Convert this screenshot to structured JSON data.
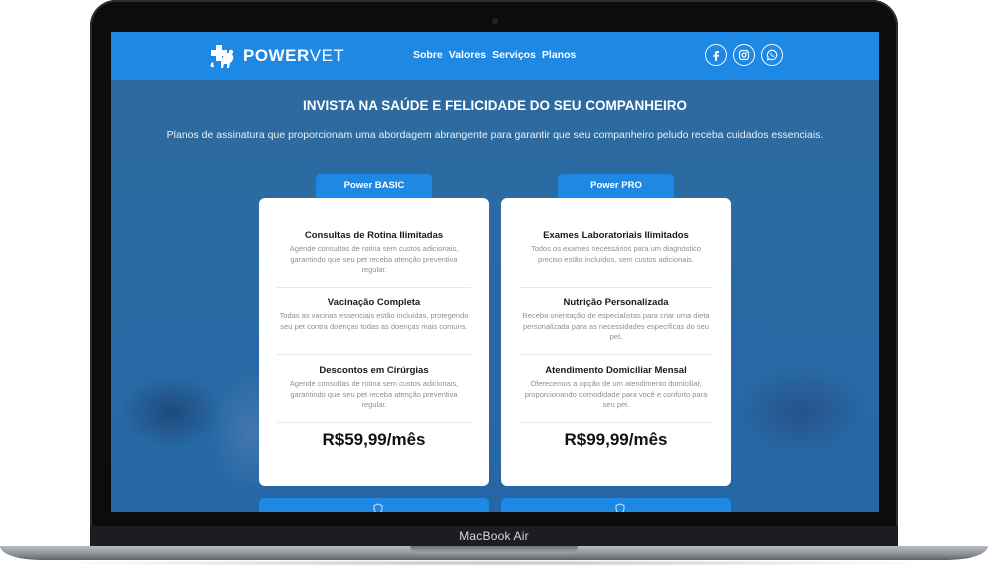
{
  "device": {
    "label": "MacBook Air"
  },
  "navbar": {
    "logo": {
      "brand_bold": "POWER",
      "brand_light": "VET",
      "icon": "pet-health-logo-icon"
    },
    "links": [
      {
        "label": "Sobre"
      },
      {
        "label": "Valores"
      },
      {
        "label": "Serviços"
      },
      {
        "label": "Planos"
      }
    ],
    "socials": [
      {
        "icon": "facebook-icon"
      },
      {
        "icon": "instagram-icon"
      },
      {
        "icon": "whatsapp-icon"
      }
    ]
  },
  "hero": {
    "title": "INVISTA NA SAÚDE E FELICIDADE DO SEU COMPANHEIRO",
    "subtitle": "Planos de assinatura que proporcionam uma abordagem abrangente para garantir que seu companheiro peludo receba cuidados essenciais."
  },
  "plans": [
    {
      "name": "Power BASIC",
      "features": [
        {
          "title": "Consultas de Rotina Ilimitadas",
          "desc": "Agende consultas de rotina sem custos adicionais, garantindo que seu pet receba atenção preventiva regular."
        },
        {
          "title": "Vacinação Completa",
          "desc": "Todas as vacinas essenciais estão incluídas, protegendo seu pet contra doenças todas as doenças mais comuns."
        },
        {
          "title": "Descontos em Cirúrgias",
          "desc": "Agende consultas de rotina sem custos adicionais, garantindo que seu pet receba atenção preventiva regular."
        }
      ],
      "price": "R$59,99/mês",
      "cta_icon": "shield-icon"
    },
    {
      "name": "Power PRO",
      "features": [
        {
          "title": "Exames Laboratoriais Ilimitados",
          "desc": "Todos os exames necessários para um diagnóstico preciso estão incluídos, sem custos adicionais."
        },
        {
          "title": "Nutrição Personalizada",
          "desc": "Receba orientação de especialistas para criar uma dieta personalizada para as necessidades específicas do seu pet."
        },
        {
          "title": "Atendimento Domiciliar Mensal",
          "desc": "Oferecemos a opção de um atendimento domiciliar, proporcionando comodidade para você e conforto para seu pet."
        }
      ],
      "price": "R$99,99/mês",
      "cta_icon": "shield-icon"
    }
  ],
  "colors": {
    "primary": "#1e88e5",
    "page_bg": "#2b6aa4",
    "card_bg": "#ffffff"
  }
}
